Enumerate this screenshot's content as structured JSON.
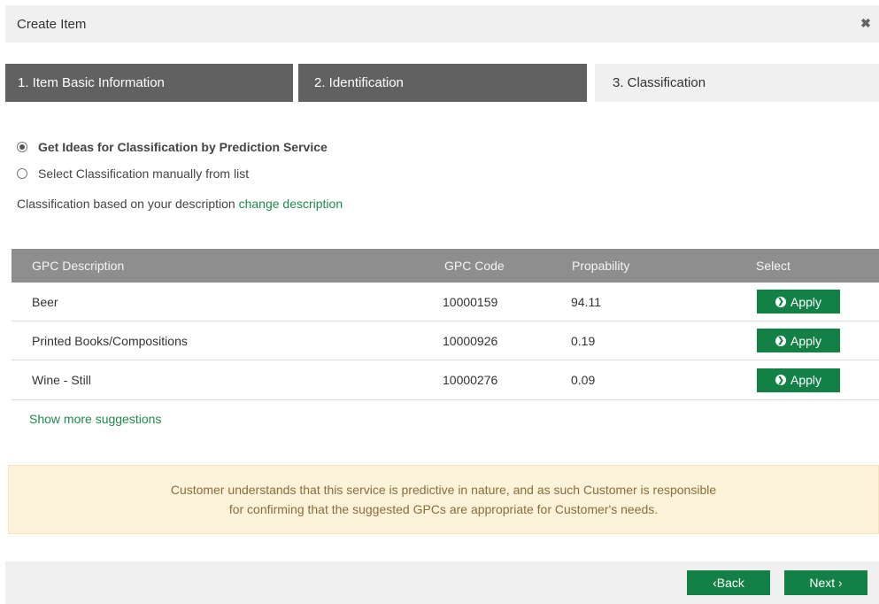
{
  "dialog": {
    "title": "Create Item",
    "close_icon": "close-icon"
  },
  "steps": [
    {
      "label": "1. Item Basic Information",
      "state": "done"
    },
    {
      "label": "2. Identification",
      "state": "done"
    },
    {
      "label": "3. Classification",
      "state": "current"
    }
  ],
  "options": {
    "prediction": {
      "label": "Get Ideas for Classification by Prediction Service",
      "checked": true
    },
    "manual": {
      "label": "Select Classification manually from list",
      "checked": false
    }
  },
  "description_line": {
    "text": "Classification based on your description",
    "link": "change description"
  },
  "table": {
    "headers": [
      "GPC Description",
      "GPC Code",
      "Propability",
      "Select"
    ],
    "rows": [
      {
        "description": "Beer",
        "code": "10000159",
        "probability": "94.11",
        "action": "Apply"
      },
      {
        "description": "Printed Books/Compositions",
        "code": "10000926",
        "probability": "0.19",
        "action": "Apply"
      },
      {
        "description": "Wine - Still",
        "code": "10000276",
        "probability": "0.09",
        "action": "Apply"
      }
    ]
  },
  "show_more": "Show more suggestions",
  "notice": {
    "line1": "Customer understands that this service is predictive in nature, and as such Customer is responsible",
    "line2": "for confirming that the suggested GPCs are appropriate for Customer's needs."
  },
  "footer": {
    "back_label": "‹Back",
    "next_label": "Next ›"
  },
  "colors": {
    "accent": "#138146",
    "link": "#1f8a4c",
    "step_done": "#616161",
    "table_header": "#8e8e8e",
    "notice_bg": "#fcf3da"
  }
}
